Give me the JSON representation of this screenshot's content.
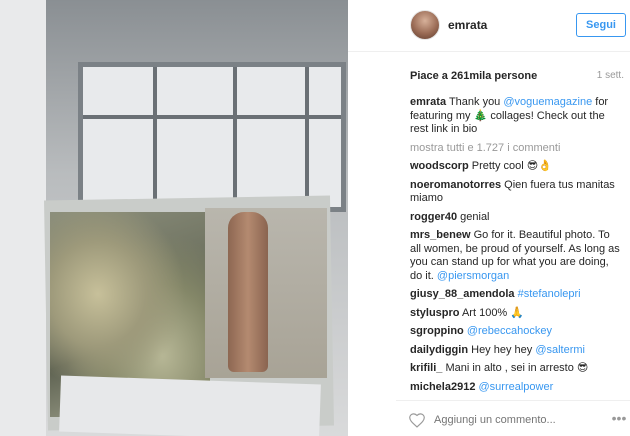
{
  "header": {
    "username": "emrata",
    "follow_label": "Segui"
  },
  "post": {
    "likes_text": "Piace a 261mila persone",
    "time_ago": "1 sett."
  },
  "caption": {
    "user": "emrata",
    "text_before": "Thank you ",
    "mention": "@voguemagazine",
    "text_after": " for featuring my 🎄 collages! Check out the rest link in bio"
  },
  "more_comments": "mostra tutti e 1.727 i commenti",
  "comments": [
    {
      "user": "woodscorp",
      "text": "Pretty cool 😎👌"
    },
    {
      "user": "noeromanotorres",
      "text": "Qien fuera tus manitas miamo"
    },
    {
      "user": "rogger40",
      "text": "genial"
    },
    {
      "user": "mrs_benew",
      "text": "Go for it. Beautiful photo. To all women, be proud of yourself. As long as you can stand up for what you are doing, do it. ",
      "mention": "@piersmorgan"
    },
    {
      "user": "giusy_88_amendola",
      "text": "",
      "mention": "#stefanolepri"
    },
    {
      "user": "styluspro",
      "text": "Art 100% 🙏"
    },
    {
      "user": "sgroppino",
      "text": "",
      "mention": "@rebeccahockey"
    },
    {
      "user": "dailydiggin",
      "text": "Hey hey hey ",
      "mention": "@saltermi"
    },
    {
      "user": "krifili_",
      "text": "Mani in alto , sei in arresto 😎"
    },
    {
      "user": "michela2912",
      "text": "",
      "mention": "@surrealpower"
    }
  ],
  "footer": {
    "add_comment_placeholder": "Aggiungi un commento...",
    "heart_icon": "heart-outline-icon",
    "more_icon": "more-options-icon"
  },
  "colors": {
    "link": "#3897f0",
    "text": "#262626",
    "muted": "#999999"
  }
}
